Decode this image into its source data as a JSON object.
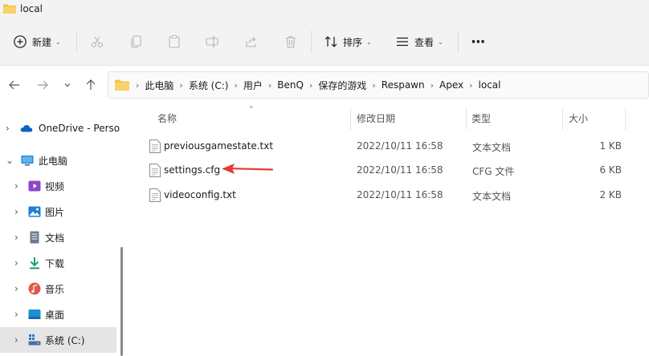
{
  "window": {
    "title": "local"
  },
  "toolbar": {
    "new_label": "新建",
    "sort_label": "排序",
    "view_label": "查看",
    "more_label": "···"
  },
  "nav": {
    "back_icon": "arrow-left-icon",
    "forward_icon": "arrow-right-icon",
    "recent_icon": "chevron-down-icon",
    "up_icon": "arrow-up-icon"
  },
  "breadcrumb": [
    "此电脑",
    "系统 (C:)",
    "用户",
    "BenQ",
    "保存的游戏",
    "Respawn",
    "Apex",
    "local"
  ],
  "sidebar": {
    "items": [
      {
        "label": "OneDrive - Perso",
        "icon": "cloud-icon",
        "color": "#0a64c8"
      },
      {
        "label": "此电脑",
        "icon": "monitor-icon",
        "color": "#1e7fd6"
      },
      {
        "label": "视频",
        "icon": "video-icon",
        "color": "#8a47c9"
      },
      {
        "label": "图片",
        "icon": "picture-icon",
        "color": "#1f7fd0"
      },
      {
        "label": "文档",
        "icon": "document-icon",
        "color": "#6b7a8c"
      },
      {
        "label": "下载",
        "icon": "download-icon",
        "color": "#1a9c6c"
      },
      {
        "label": "音乐",
        "icon": "music-icon",
        "color": "#e0584a"
      },
      {
        "label": "桌面",
        "icon": "desktop-icon",
        "color": "#1d8fd6"
      },
      {
        "label": "系统 (C:)",
        "icon": "drive-icon",
        "color": "#4a6fa5"
      }
    ]
  },
  "columns": {
    "name": "名称",
    "date": "修改日期",
    "type": "类型",
    "size": "大小"
  },
  "files": [
    {
      "name": "previousgamestate.txt",
      "date": "2022/10/11 16:58",
      "type": "文本文档",
      "size": "1 KB"
    },
    {
      "name": "settings.cfg",
      "date": "2022/10/11 16:58",
      "type": "CFG 文件",
      "size": "6 KB"
    },
    {
      "name": "videoconfig.txt",
      "date": "2022/10/11 16:58",
      "type": "文本文档",
      "size": "2 KB"
    }
  ],
  "colors": {
    "folder": "#f2c14e",
    "annotation_arrow": "#e53935",
    "selected_bg": "#e5e5e5"
  }
}
